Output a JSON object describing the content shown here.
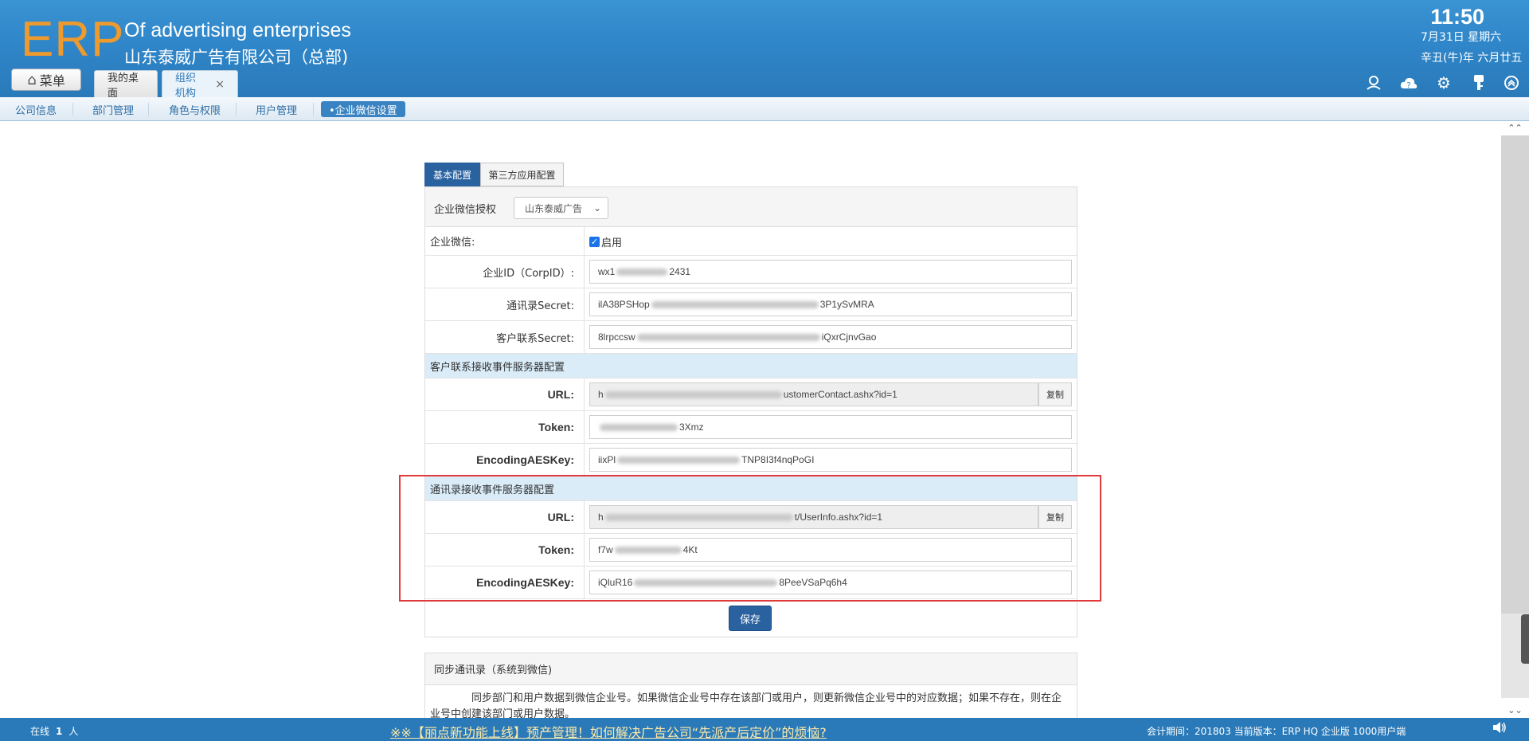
{
  "header": {
    "logo": "ERP",
    "company_en": "Of advertising enterprises",
    "company_cn": "山东泰威广告有限公司（总部)",
    "time": "11:50",
    "date": "7月31日 星期六",
    "lunar": "辛丑(牛)年 六月廿五",
    "menu_label": "菜单",
    "tabs": [
      {
        "label": "我的桌面"
      },
      {
        "label": "组织机构"
      }
    ],
    "icons": [
      "user-icon",
      "help-cloud-icon",
      "gear-icon",
      "key-icon",
      "collapse-icon"
    ]
  },
  "subnav": {
    "items": [
      {
        "label": "公司信息"
      },
      {
        "label": "部门管理"
      },
      {
        "label": "角色与权限"
      },
      {
        "label": "用户管理"
      },
      {
        "label": "•企业微信设置"
      }
    ]
  },
  "main": {
    "tabs": [
      {
        "label": "基本配置"
      },
      {
        "label": "第三方应用配置"
      }
    ],
    "auth": {
      "label": "企业微信授权",
      "selected": "山东泰威广告"
    },
    "enable": {
      "label": "企业微信:",
      "checkbox_label": "启用",
      "checked": true
    },
    "corp_id": {
      "label": "企业ID（CorpID）:",
      "prefix": "wx1",
      "suffix": "2431"
    },
    "contacts_secret": {
      "label": "通讯录Secret:",
      "prefix": "ilA38PSHop",
      "suffix": "3P1ySvMRA"
    },
    "customer_secret": {
      "label": "客户联系Secret:",
      "prefix": "8lrpccsw",
      "suffix": "iQxrCjnvGao"
    },
    "customer_section": {
      "title": "客户联系接收事件服务器配置",
      "url_label": "URL:",
      "url_prefix": "h",
      "url_suffix": "ustomerContact.ashx?id=1",
      "copy_label": "复制",
      "token_label": "Token:",
      "token_suffix": "3Xmz",
      "aes_label": "EncodingAESKey:",
      "aes_prefix": "iixPl",
      "aes_suffix": "TNP8I3f4nqPoGI"
    },
    "contacts_section": {
      "title": "通讯录接收事件服务器配置",
      "url_label": "URL:",
      "url_prefix": "h",
      "url_suffix": "t/UserInfo.ashx?id=1",
      "copy_label": "复制",
      "token_label": "Token:",
      "token_prefix": "f7w",
      "token_suffix": "4Kt",
      "aes_label": "EncodingAESKey:",
      "aes_prefix": "iQluR16",
      "aes_suffix": "8PeeVSaPq6h4"
    },
    "save_label": "保存",
    "sync": {
      "title": "同步通讯录（系统到微信)",
      "desc": "同步部门和用户数据到微信企业号。如果微信企业号中存在该部门或用户，则更新微信企业号中的对应数据；如果不存在，则在企业号中创建该部门或用户数据。"
    }
  },
  "footer": {
    "online_label": "在线",
    "online_count": "1",
    "online_unit": "人",
    "news": "※※【丽点新功能上线】预产管理！如何解决广告公司“先派产后定价”的烦恼?",
    "version": "会计期间：201803 当前版本：ERP HQ 企业版 1000用户端"
  },
  "colors": {
    "header_blue": "#2f86c9",
    "logo_orange": "#ef9a2d",
    "primary_button": "#2a62a0",
    "section_bg": "#d9ecf8",
    "highlight_red": "#e03a3a"
  }
}
